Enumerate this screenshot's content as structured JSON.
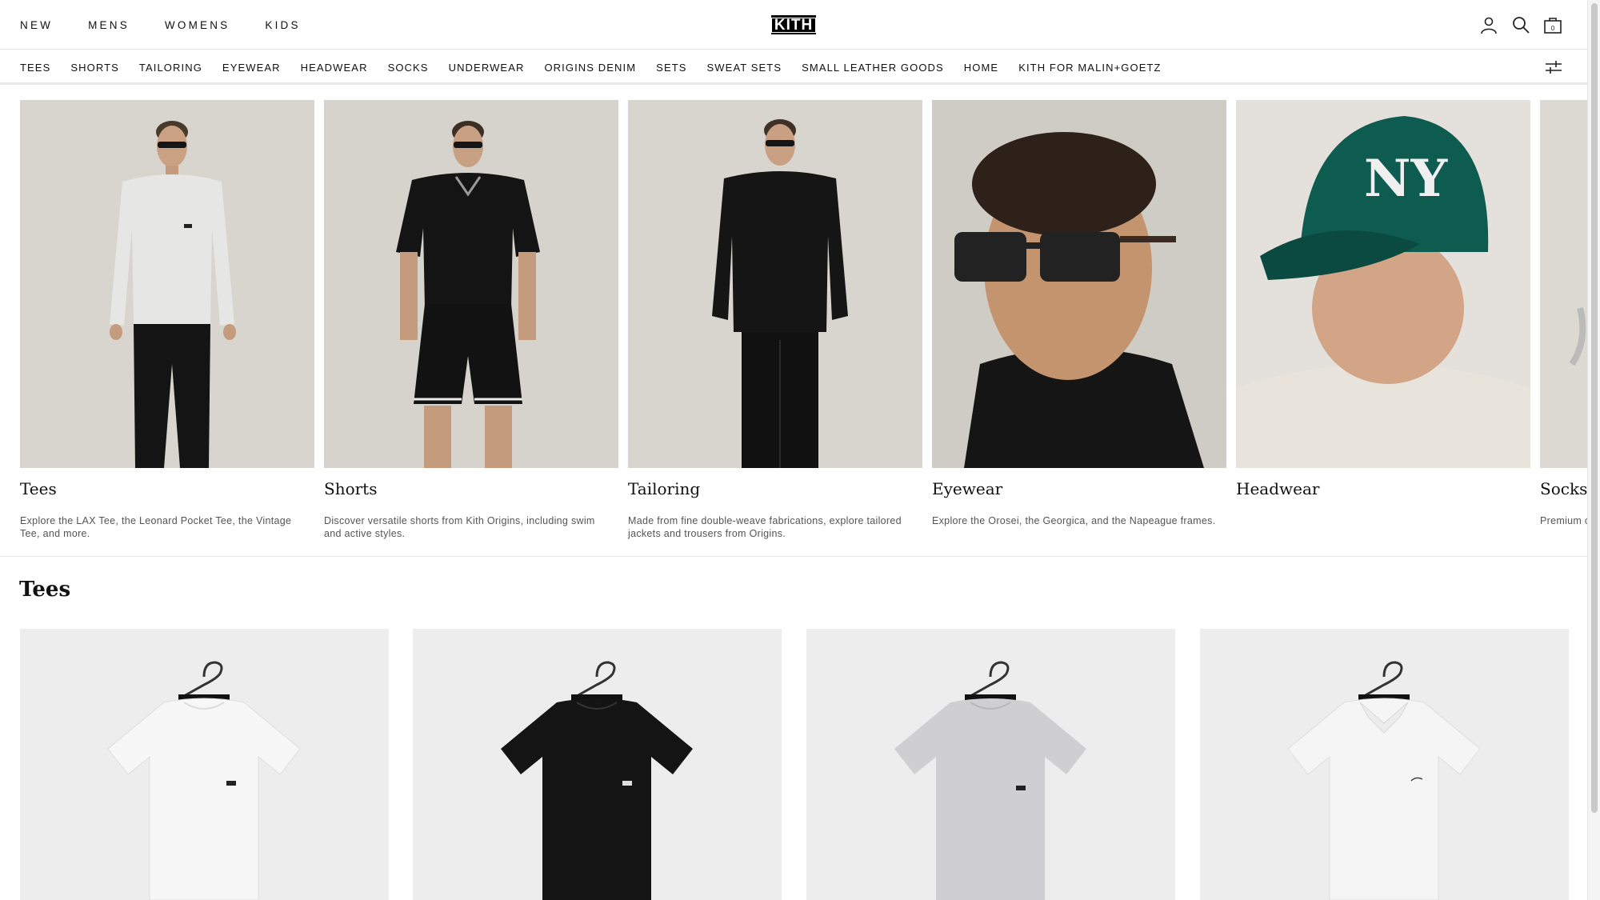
{
  "header": {
    "main_nav": [
      "NEW",
      "MENS",
      "WOMENS",
      "KIDS"
    ],
    "logo_text": "KITH",
    "icons": [
      "account-icon",
      "search-icon",
      "bag-icon"
    ],
    "bag_count": "0"
  },
  "sub_nav": [
    "TEES",
    "SHORTS",
    "TAILORING",
    "EYEWEAR",
    "HEADWEAR",
    "SOCKS",
    "UNDERWEAR",
    "ORIGINS DENIM",
    "SETS",
    "SWEAT SETS",
    "SMALL LEATHER GOODS",
    "HOME",
    "KITH FOR MALIN+GOETZ"
  ],
  "filter_icon": "filter-sliders-icon",
  "categories": [
    {
      "name": "Tees",
      "description": "Explore the LAX Tee, the Leonard Pocket Tee, the Vintage Tee, and more."
    },
    {
      "name": "Shorts",
      "description": "Discover versatile shorts from Kith Origins, including swim and active styles."
    },
    {
      "name": "Tailoring",
      "description": "Made from fine double-weave fabrications, explore tailored jackets and trousers from Origins."
    },
    {
      "name": "Eyewear",
      "description": "Explore the Orosei, the Georgica, and the Napeague frames."
    },
    {
      "name": "Headwear",
      "description": ""
    },
    {
      "name": "Socks",
      "description": "Premium c... Stance."
    }
  ],
  "section": {
    "title": "Tees"
  },
  "products": [
    {
      "color": "white"
    },
    {
      "color": "black"
    },
    {
      "color": "heather grey"
    },
    {
      "color": "white polo"
    }
  ],
  "colors": {
    "background": "#ffffff",
    "image_bg": "#d9d6d0",
    "product_bg": "#ededed",
    "cap_green": "#0e5c4f"
  }
}
